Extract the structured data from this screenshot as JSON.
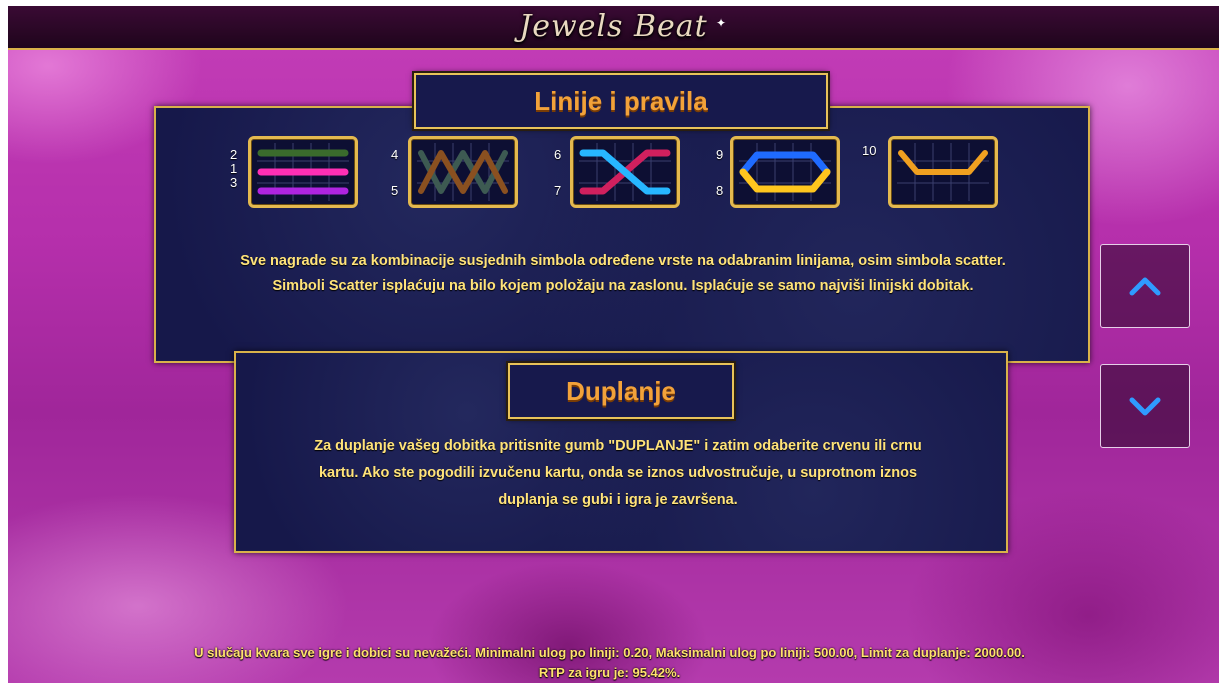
{
  "game": {
    "title": "Jewels Beat"
  },
  "lines_section": {
    "heading": "Linije i pravila",
    "text_line1": "Sve nagrade su za kombinacije susjednih simbola određene vrste na odabranim linijama, osim simbola scatter.",
    "text_line2": "Simboli Scatter isplaćuju na bilo kojem položaju na zaslonu. Isplaćuje se samo najviši linijski dobitak.",
    "cards": [
      {
        "numbers": [
          "2",
          "1",
          "3"
        ],
        "line_colors": [
          "#3a6b2c",
          "#ff2fb4",
          "#b024e0"
        ]
      },
      {
        "numbers": [
          "4",
          "5"
        ],
        "line_colors": [
          "#3d5a52",
          "#8a5020"
        ]
      },
      {
        "numbers": [
          "6",
          "7"
        ],
        "line_colors": [
          "#27b7ff",
          "#d0205e"
        ]
      },
      {
        "numbers": [
          "9",
          "8"
        ],
        "line_colors": [
          "#1f6bff",
          "#ffc61e"
        ]
      },
      {
        "numbers": [
          "10"
        ],
        "line_colors": [
          "#f0a020"
        ]
      }
    ]
  },
  "double_section": {
    "heading": "Duplanje",
    "text_line1": "Za duplanje vašeg dobitka pritisnite gumb \"DUPLANJE\" i zatim odaberite crvenu ili crnu",
    "text_line2": "kartu. Ako ste pogodili izvučenu kartu, onda se iznos udvostručuje, u suprotnom iznos",
    "text_line3": "duplanja se gubi i igra je završena."
  },
  "nav": {
    "up_icon": "chevron-up-icon",
    "down_icon": "chevron-down-icon",
    "accent": "#2f9bff"
  },
  "footer": {
    "line1": "U slučaju kvara sve igre i dobici su nevažeći. Minimalni ulog po liniji: 0.20, Maksimalni ulog po liniji: 500.00, Limit za duplanje: 2000.00.",
    "line2": "RTP za igru je: 95.42%."
  }
}
